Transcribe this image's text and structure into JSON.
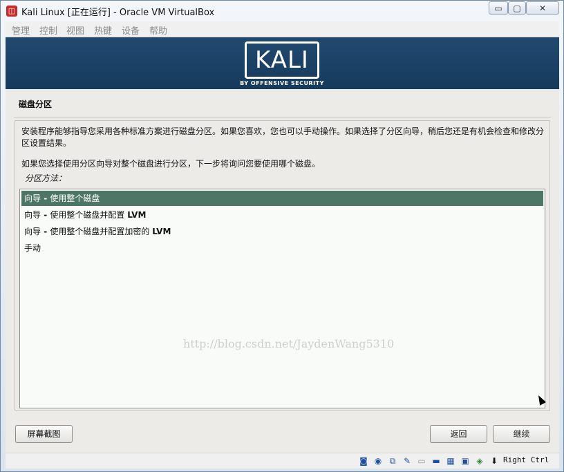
{
  "window": {
    "title": "Kali Linux [正在运行] - Oracle VM VirtualBox",
    "app_icon": "virtualbox-icon",
    "controls": {
      "minimize": "▭",
      "maximize": "▢",
      "close": "✕"
    }
  },
  "menubar": {
    "items": [
      "管理",
      "控制",
      "视图",
      "热键",
      "设备",
      "帮助"
    ]
  },
  "banner": {
    "logo_text": "KALI",
    "logo_subtext": "BY OFFENSIVE SECURITY"
  },
  "installer": {
    "section_title": "磁盘分区",
    "description_1": "安装程序能够指导您采用各种标准方案进行磁盘分区。如果您喜欢，您也可以手动操作。如果选择了分区向导，稍后您还是有机会检查和修改分区设置结果。",
    "description_2": "如果您选择使用分区向导对整个磁盘进行分区，下一步将询问您要使用哪个磁盘。",
    "list_label": "分区方法：",
    "options": [
      {
        "prefix": "向导",
        "sep": " - ",
        "text": "使用整个磁盘",
        "suffix": "",
        "selected": true
      },
      {
        "prefix": "向导",
        "sep": " - ",
        "text": "使用整个磁盘并配置 ",
        "suffix": "LVM",
        "selected": false
      },
      {
        "prefix": "向导",
        "sep": " - ",
        "text": "使用整个磁盘并配置加密的 ",
        "suffix": "LVM",
        "selected": false
      },
      {
        "prefix": "手动",
        "sep": "",
        "text": "",
        "suffix": "",
        "selected": false
      }
    ],
    "watermark": "http://blog.csdn.net/JaydenWang5310",
    "buttons": {
      "screenshot": "屏幕截图",
      "back": "返回",
      "continue": "继续"
    }
  },
  "statusbar": {
    "icons": [
      "hard-disk-icon",
      "optical-drive-icon",
      "network-icon",
      "usb-icon",
      "shared-folder-icon",
      "display-icon",
      "network-adapter-icon",
      "recording-icon",
      "mouse-integration-icon",
      "keyboard-capture-icon"
    ],
    "host_key": "Right Ctrl"
  },
  "colors": {
    "banner": "#1c4468",
    "selected_row": "#4d7666"
  }
}
